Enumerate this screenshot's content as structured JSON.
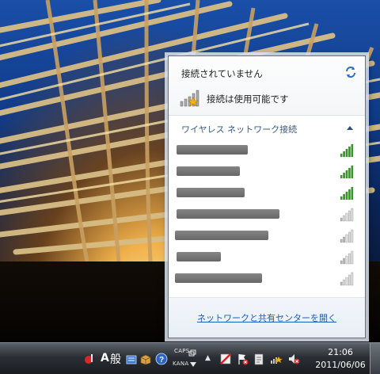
{
  "flyout": {
    "status": "接続されていません",
    "available": "接続は使用可能です",
    "section_title": "ワイヤレス ネットワーク接続",
    "networks": [
      {
        "name": "",
        "signal": 5,
        "color": "green"
      },
      {
        "name": "",
        "signal": 5,
        "color": "green"
      },
      {
        "name": "",
        "signal": 5,
        "color": "green"
      },
      {
        "name": "",
        "signal": 1,
        "color": "gray"
      },
      {
        "name": "",
        "signal": 2,
        "color": "gray"
      },
      {
        "name": "",
        "signal": 2,
        "color": "gray"
      },
      {
        "name": "",
        "signal": 1,
        "color": "gray"
      }
    ],
    "footer_link": "ネットワークと共有センターを開く"
  },
  "taskbar": {
    "ime_mode": "A",
    "ime_kanji": "般",
    "caps": "CAPS",
    "kana": "KANA",
    "time": "21:06",
    "date": "2011/06/06"
  },
  "colors": {
    "link": "#1c5fb8",
    "signal_active": "#2e9a1e",
    "signal_inactive": "#b8b8b8"
  }
}
